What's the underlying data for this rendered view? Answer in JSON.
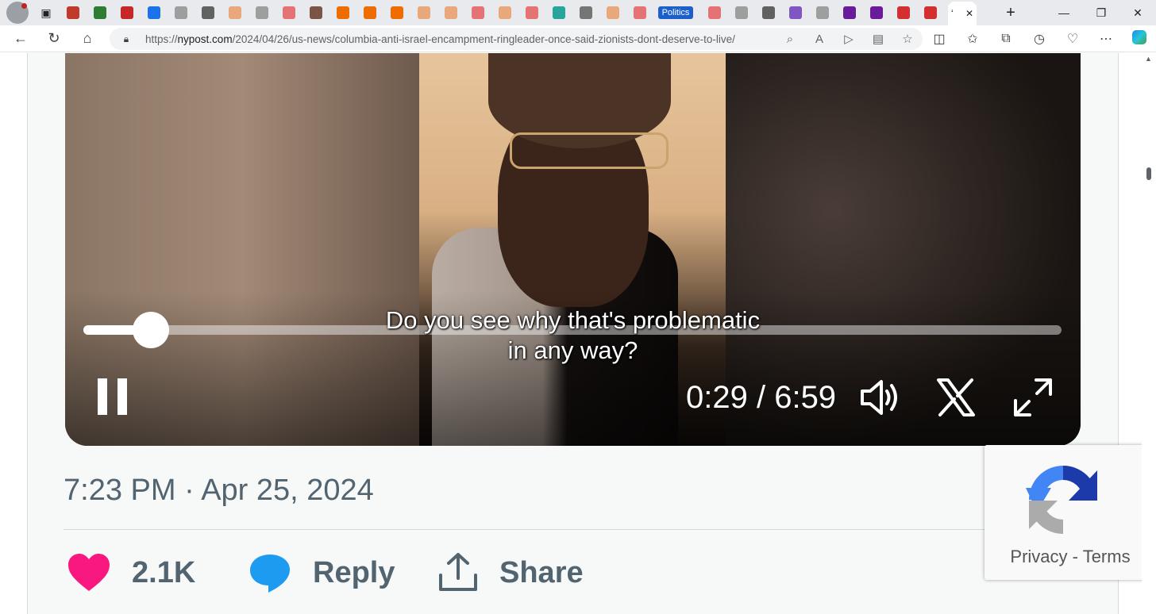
{
  "browser": {
    "address": {
      "url_prefix": "https://",
      "url_host": "nypost.com",
      "url_path": "/2024/04/26/us-news/columbia-anti-israel-encampment-ringleader-once-said-zionists-dont-deserve-to-live/"
    },
    "tabs": {
      "politics_label": "Politics",
      "tab_colors": [
        "#c0392b",
        "#2e7d32",
        "#c62828",
        "#1a73e8",
        "#9e9e9e",
        "#616161",
        "#e8a87c",
        "#9e9e9e",
        "#e57373",
        "#795548",
        "#ef6c00",
        "#ef6c00",
        "#ef6c00",
        "#e8a87c",
        "#e8a87c",
        "#e57373",
        "#e8a87c",
        "#e57373",
        "#26a69a",
        "#757575",
        "#e8a87c",
        "#e57373"
      ],
      "tab_colors_after": [
        "#e57373",
        "#9e9e9e",
        "#616161",
        "#7e57c2",
        "#9e9e9e",
        "#6a1b9a",
        "#6a1b9a",
        "#d32f2f",
        "#d32f2f"
      ]
    },
    "window_controls": {
      "minimize": "—",
      "restore": "❐",
      "close": "✕"
    }
  },
  "video": {
    "caption_line1": "Do you see why that's problematic",
    "caption_line2": "in any way?",
    "current_time": "0:29",
    "time_separator": " / ",
    "duration": "6:59",
    "progress_fraction": 0.069,
    "state": "playing",
    "controls": [
      "pause-icon",
      "volume-icon",
      "x-logo-icon",
      "fullscreen-icon"
    ]
  },
  "tweet": {
    "timestamp": "7:23 PM · Apr 25, 2024",
    "like_count": "2.1K",
    "reply_label": "Reply",
    "share_label": "Share",
    "like_color": "#f91880",
    "reply_color": "#1d9bf0"
  },
  "recaptcha": {
    "privacy_label": "Privacy",
    "separator": " - ",
    "terms_label": "Terms"
  }
}
